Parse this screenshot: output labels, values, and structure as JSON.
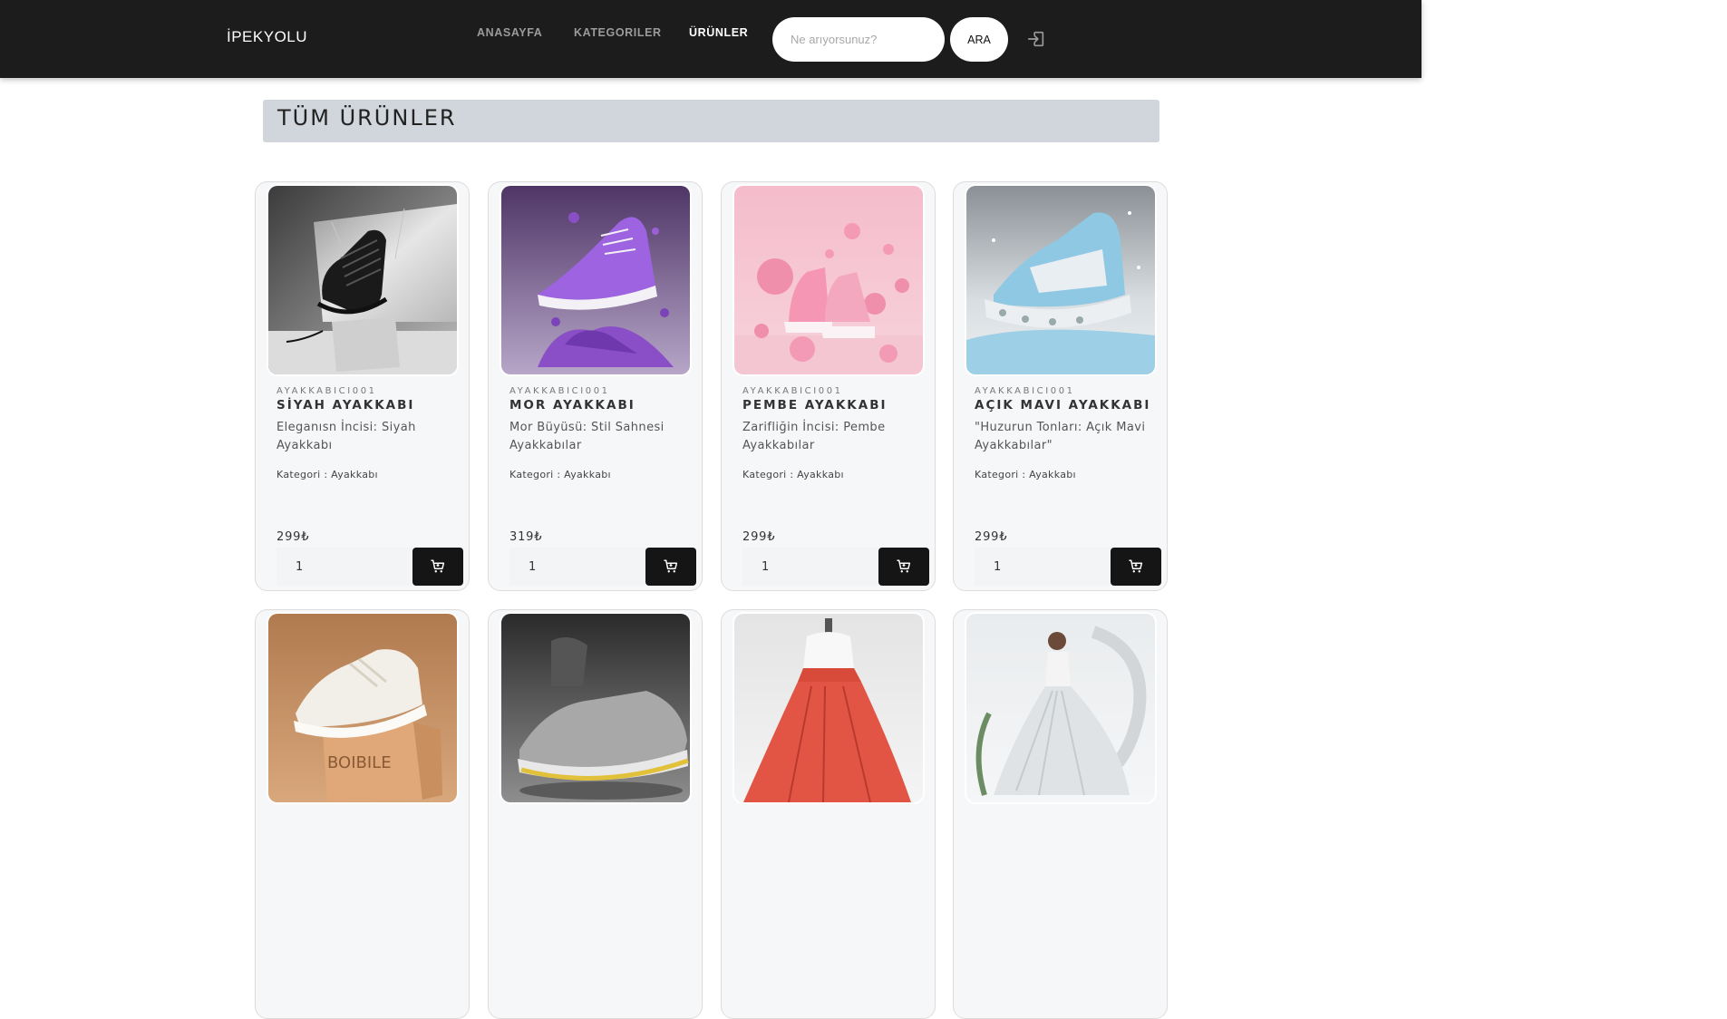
{
  "nav": {
    "brand": "İPEKYOLU",
    "links": [
      {
        "label": "ANASAYFA",
        "active": false
      },
      {
        "label": "KATEGORILER",
        "active": false
      },
      {
        "label": "ÜRÜNLER",
        "active": true
      }
    ],
    "search_placeholder": "Ne arıyorsunuz?",
    "search_button": "ARA",
    "login_icon": "login-icon"
  },
  "page": {
    "title": "TÜM ÜRÜNLER"
  },
  "products": [
    {
      "sku": "AYAKKABICI001",
      "name": "SİYAH AYAKKABI",
      "description": "Eleganısn İncisi: Siyah Ayakkabı",
      "category": "Kategori : Ayakkabı",
      "price": "299₺",
      "quantity": "1",
      "image": "black-sneaker-image"
    },
    {
      "sku": "AYAKKABICI001",
      "name": "MOR AYAKKABI",
      "description": "Mor Büyüsü: Stil Sahnesi Ayakkabılar",
      "category": "Kategori : Ayakkabı",
      "price": "319₺",
      "quantity": "1",
      "image": "purple-sneaker-image"
    },
    {
      "sku": "AYAKKABICI001",
      "name": "PEMBE AYAKKABI",
      "description": "Zarifliğin İncisi: Pembe Ayakkabılar",
      "category": "Kategori : Ayakkabı",
      "price": "299₺",
      "quantity": "1",
      "image": "pink-sneaker-image"
    },
    {
      "sku": "AYAKKABICI001",
      "name": "AÇIK MAVI AYAKKABI",
      "description": "\"Huzurun Tonları: Açık Mavi Ayakkabılar\"",
      "category": "Kategori : Ayakkabı",
      "price": "299₺",
      "quantity": "1",
      "image": "light-blue-sneaker-image"
    },
    {
      "image": "white-sneaker-on-box-image",
      "box_text": "BOIBILE"
    },
    {
      "image": "grey-yellow-sneaker-image"
    },
    {
      "image": "red-skirt-dress-image"
    },
    {
      "image": "white-gown-image"
    }
  ]
}
